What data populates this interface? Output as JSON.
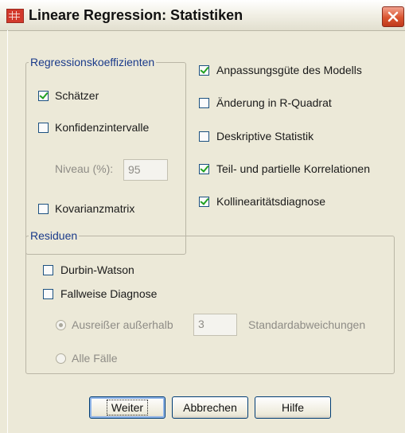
{
  "window": {
    "title": "Lineare Regression: Statistiken"
  },
  "coefficients": {
    "legend": "Regressionskoeffizienten",
    "estimates": {
      "label": "Schätzer",
      "checked": true
    },
    "conf_intervals": {
      "label": "Konfidenzintervalle",
      "checked": false
    },
    "level_label": "Niveau (%):",
    "level_value": "95",
    "cov_matrix": {
      "label": "Kovarianzmatrix",
      "checked": false
    }
  },
  "options": {
    "model_fit": {
      "label": "Anpassungsgüte des Modells",
      "checked": true
    },
    "r_squared_change": {
      "label": "Änderung in R-Quadrat",
      "checked": false
    },
    "descriptives": {
      "label": "Deskriptive Statistik",
      "checked": false
    },
    "part_partial": {
      "label": "Teil- und partielle Korrelationen",
      "checked": true
    },
    "collinearity": {
      "label": "Kollinearitätsdiagnose",
      "checked": true
    }
  },
  "residuals": {
    "legend": "Residuen",
    "durbin_watson": {
      "label": "Durbin-Watson",
      "checked": false
    },
    "casewise": {
      "label": "Fallweise Diagnose",
      "checked": false
    },
    "outliers_label": "Ausreißer außerhalb",
    "outliers_value": "3",
    "std_dev_label": "Standardabweichungen",
    "all_cases_label": "Alle Fälle"
  },
  "buttons": {
    "continue": "Weiter",
    "cancel": "Abbrechen",
    "help": "Hilfe"
  },
  "colors": {
    "legend": "#1a3a8a",
    "check": "#21a121",
    "close": "#d9542f"
  }
}
